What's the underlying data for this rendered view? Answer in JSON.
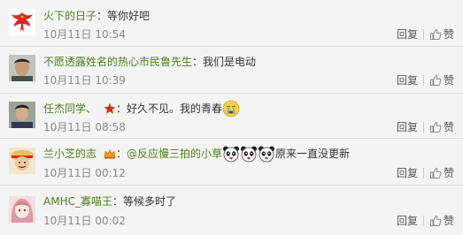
{
  "comments": [
    {
      "name": "火下的日子",
      "colon": "：",
      "text": "等你好吧",
      "time": "10月11日 10:54",
      "reply_label": "回复",
      "like_label": "赞",
      "avatar_icon": "phoenix-avatar-icon"
    },
    {
      "name": "不愿透露姓名的热心市民鲁先生",
      "colon": "：",
      "text": "我们是电动",
      "time": "10月11日 10:39",
      "reply_label": "回复",
      "like_label": "赞",
      "avatar_icon": "person-avatar-icon"
    },
    {
      "name": "任杰同学、",
      "badge_icon": "red-star-badge-icon",
      "colon": "：",
      "text": "好久不见。我的青春",
      "emoticon": "crying-face-icon",
      "time": "10月11日 08:58",
      "reply_label": "回复",
      "like_label": "赞",
      "avatar_icon": "person-avatar-icon"
    },
    {
      "name": "兰小芝的志",
      "badge_icon": "crown-badge-icon",
      "colon": "：",
      "mention": "@反应慢三拍的小草",
      "emoticons": [
        "panda-face-icon",
        "panda-face-icon",
        "panda-face-icon"
      ],
      "text": "原来一直没更新",
      "time": "10月11日 00:12",
      "reply_label": "回复",
      "like_label": "赞",
      "avatar_icon": "cartoon-avatar-icon"
    },
    {
      "name": "AMHC_寡喵王",
      "colon": "：",
      "text": "等候多时了",
      "time": "10月11日 00:02",
      "reply_label": "回复",
      "like_label": "赞",
      "avatar_icon": "anime-avatar-icon"
    }
  ],
  "colors": {
    "name": "#4c7d1c",
    "time": "#888888",
    "text": "#333333",
    "background": "#f4f4f4",
    "separator": "#dddddd"
  }
}
